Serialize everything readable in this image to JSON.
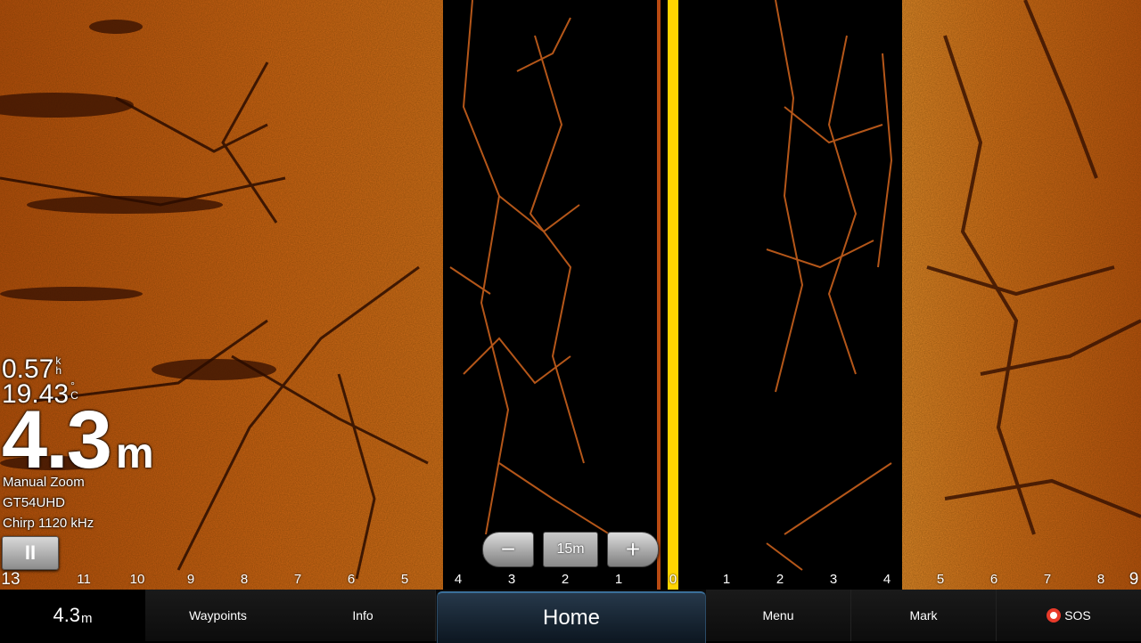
{
  "readouts": {
    "speed_value": "0.57",
    "speed_unit_top": "k",
    "speed_unit_bottom": "h",
    "temp_value": "19.43",
    "temp_unit_top": "°",
    "temp_unit_bottom": "C",
    "depth_value": "4.3",
    "depth_unit": "m",
    "zoom_mode": "Manual Zoom",
    "transducer": "GT54UHD",
    "frequency": "Chirp 1120 kHz"
  },
  "controls": {
    "pause_label": "II",
    "zoom_out_label": "−",
    "range_label": "15m",
    "zoom_in_label": "+"
  },
  "range_ticks": [
    "13",
    "11",
    "10",
    "9",
    "8",
    "7",
    "6",
    "5",
    "4",
    "3",
    "2",
    "1",
    "0",
    "1",
    "2",
    "3",
    "4",
    "5",
    "6",
    "7",
    "8",
    "9"
  ],
  "bottom_nav": {
    "depth_value": "4.3",
    "depth_unit": "m",
    "waypoints": "Waypoints",
    "info": "Info",
    "home": "Home",
    "menu": "Menu",
    "mark": "Mark",
    "sos": "SOS"
  },
  "colors": {
    "sonar_bright": "#d9741a",
    "sonar_dark": "#8a3608",
    "center_line": "#ffd400",
    "sos_ring": "#e83a2a",
    "home_accent": "#3a6f9a"
  }
}
